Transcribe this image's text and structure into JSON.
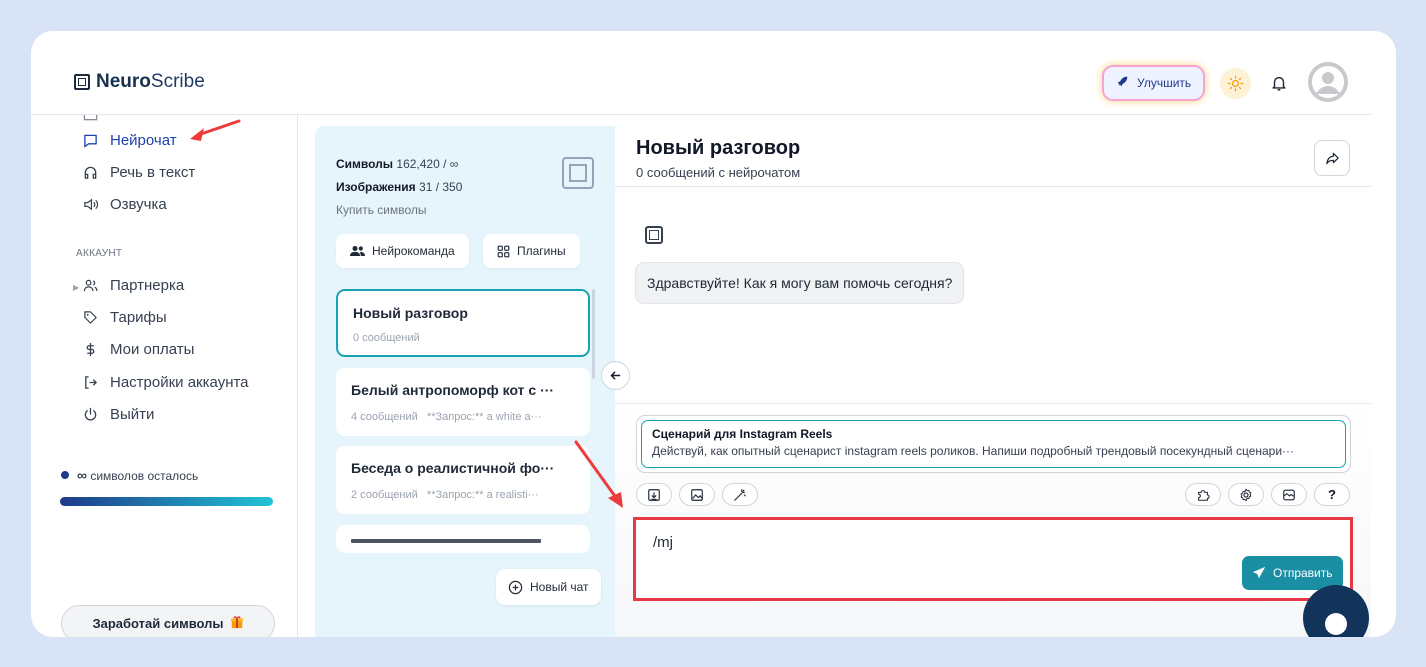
{
  "header": {
    "logo_bold": "Neuro",
    "logo_rest": "Scribe",
    "upgrade_label": "Улучшить"
  },
  "sidebar": {
    "items": [
      {
        "label": "Нейрочат",
        "icon": "chat-bubble-icon",
        "active": true
      },
      {
        "label": "Речь в текст",
        "icon": "headphones-icon"
      },
      {
        "label": "Озвучка",
        "icon": "speaker-icon"
      }
    ],
    "account_section": "АККАУНТ",
    "account_items": [
      {
        "label": "Партнерка",
        "icon": "users-icon"
      },
      {
        "label": "Тарифы",
        "icon": "tag-icon"
      },
      {
        "label": "Мои оплаты",
        "icon": "dollar-icon"
      },
      {
        "label": "Настройки аккаунта",
        "icon": "login-icon"
      },
      {
        "label": "Выйти",
        "icon": "power-icon"
      }
    ],
    "credits_symbol": "∞",
    "credits_text": "символов осталось",
    "earn_label": "Заработай символы"
  },
  "panel": {
    "symbols_label": "Символы",
    "symbols_value": "162,420 / ∞",
    "images_label": "Изображения",
    "images_value": "31 / 350",
    "buy_label": "Купить символы",
    "team_label": "Нейрокоманда",
    "plugins_label": "Плагины",
    "chats": [
      {
        "title": "Новый разговор",
        "count": "0 сообщений",
        "preview": "",
        "active": true
      },
      {
        "title": "Белый антропоморф кот с ···",
        "count": "4 сообщений",
        "preview": "**Запрос:** a white a···"
      },
      {
        "title": "Беседа о реалистичной фо···",
        "count": "2 сообщений",
        "preview": "**Запрос:** a realisti···"
      }
    ],
    "new_chat_label": "Новый чат"
  },
  "chat": {
    "title": "Новый разговор",
    "subtitle": "0 сообщений с нейрочатом",
    "greeting": "Здравствуйте! Как я могу вам помочь сегодня?",
    "prompt_title": "Сценарий для Instagram Reels",
    "prompt_text": "Действуй, как опытный сценарист instagram reels роликов. Напиши подробный трендовый посекундный сценари···",
    "input_value": "/mj",
    "send_label": "Отправить",
    "help_label": "?"
  },
  "colors": {
    "accent": "#1a8fa3",
    "highlight": "#e53946",
    "panel_bg": "#e6f5fc",
    "page_bg": "#d9e3f6"
  }
}
